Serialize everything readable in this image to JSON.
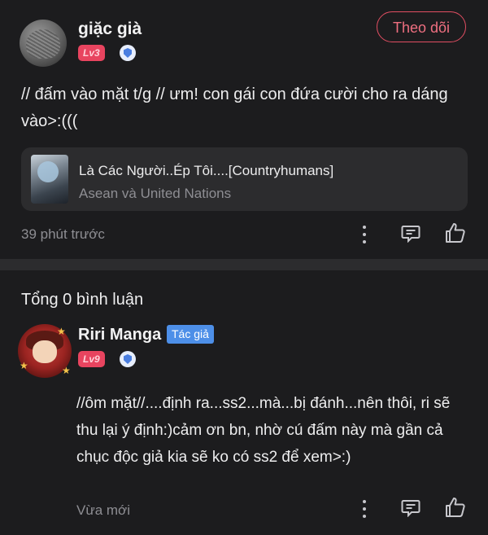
{
  "post": {
    "author": "giặc già",
    "level": "Lv3",
    "follow_label": "Theo dõi",
    "text": "// đấm vào mặt t/g // ưm! con gái con đứa cười cho ra dáng vào>:(((",
    "card": {
      "title": "Là Các Người..Ép Tôi....[Countryhumans]",
      "subtitle": "Asean và United Nations"
    },
    "time": "39 phút trước"
  },
  "comments_header": "Tổng 0 bình luận",
  "comment": {
    "author": "Riri Manga",
    "tag": "Tác giả",
    "level": "Lv9",
    "text": "//ôm mặt//....định ra...ss2...mà...bị đánh...nên thôi, ri sẽ thu lại ý định:)cảm ơn bn, nhờ cú đấm này mà gần cả chục độc giả kia sẽ ko có ss2 để xem>:)",
    "time": "Vừa mới"
  },
  "colors": {
    "background": "#1c1c1e",
    "accent": "#e14e62",
    "card": "#2c2c2e",
    "author_tag": "#4d8fe8"
  },
  "icons": [
    "more-icon",
    "comment-icon",
    "like-icon",
    "verified-shield-icon"
  ]
}
